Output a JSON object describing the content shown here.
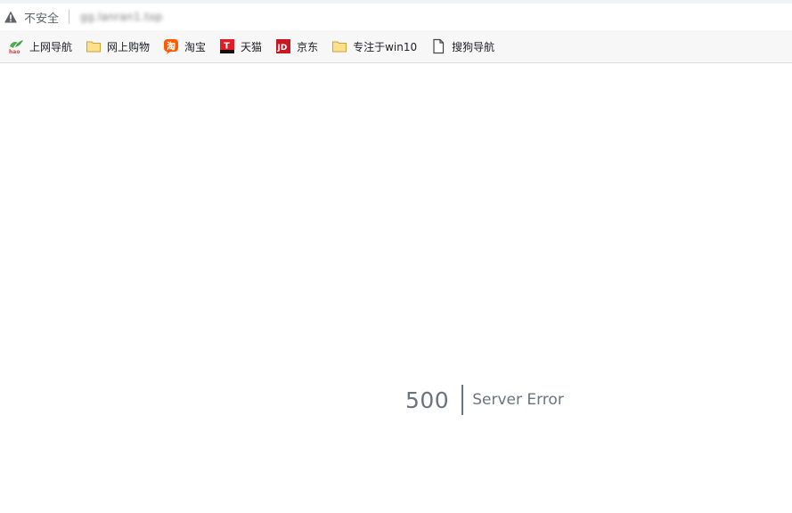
{
  "browser": {
    "security_label": "不安全",
    "url": "gg.lanran1.top"
  },
  "bookmarks": [
    {
      "label": "上网导航",
      "icon": "hao-icon"
    },
    {
      "label": "网上购物",
      "icon": "folder-icon"
    },
    {
      "label": "淘宝",
      "icon": "taobao-icon"
    },
    {
      "label": "天猫",
      "icon": "tmall-icon"
    },
    {
      "label": "京东",
      "icon": "jd-icon"
    },
    {
      "label": "专注于win10",
      "icon": "folder-icon"
    },
    {
      "label": "搜狗导航",
      "icon": "page-icon"
    }
  ],
  "error": {
    "code": "500",
    "message": "Server Error"
  }
}
